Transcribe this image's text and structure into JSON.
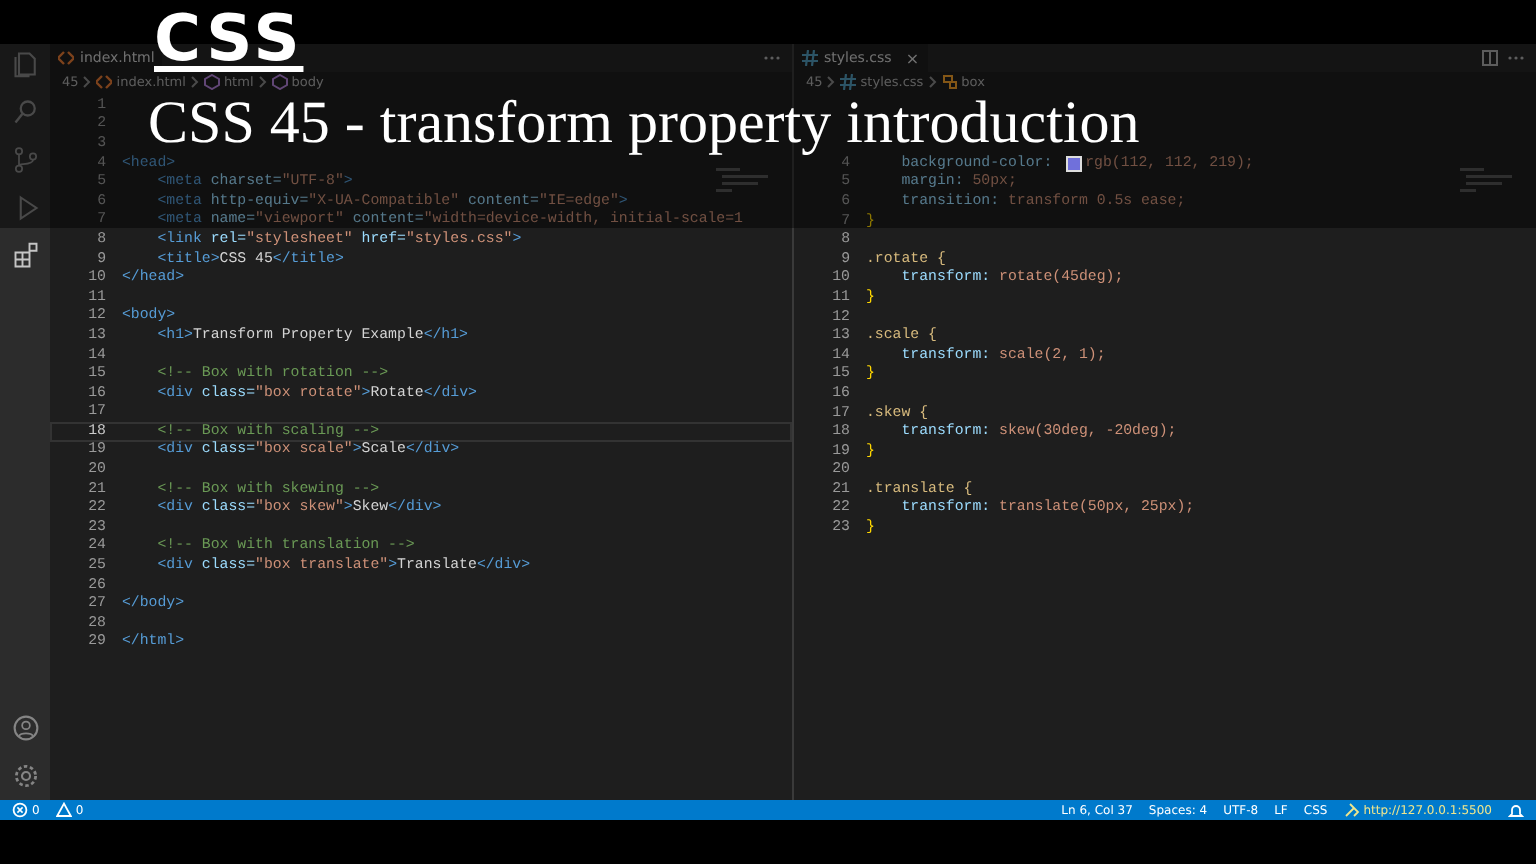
{
  "overlay": {
    "badge": "CSS",
    "title": "CSS 45 - transform property introduction"
  },
  "activity_bar": {
    "top": [
      {
        "kind": "files"
      },
      {
        "kind": "search"
      },
      {
        "kind": "source-control"
      },
      {
        "kind": "run"
      },
      {
        "kind": "extensions"
      }
    ],
    "bottom": [
      {
        "kind": "account"
      },
      {
        "kind": "settings"
      }
    ]
  },
  "editors": [
    {
      "tab": {
        "label": "index.html"
      },
      "breadcrumb": [
        {
          "text": "45"
        },
        {
          "text": "index.html"
        },
        {
          "text": "html"
        },
        {
          "text": "body"
        }
      ],
      "lines": [
        {
          "n": "1",
          "current": false
        },
        {
          "n": "2",
          "current": false
        },
        {
          "n": "3",
          "current": false
        },
        {
          "n": "4",
          "current": false,
          "tokens": [
            {
              "text": "<head>",
              "kind": "tag"
            }
          ]
        },
        {
          "n": "5",
          "current": false,
          "tokens": [
            {
              "text": "    <meta ",
              "kind": "tag"
            },
            {
              "text": "charset=",
              "kind": "attr"
            },
            {
              "text": "\"UTF-8\"",
              "kind": "str"
            },
            {
              "text": ">",
              "kind": "tag"
            }
          ]
        },
        {
          "n": "6",
          "current": false,
          "tokens": [
            {
              "text": "    <meta ",
              "kind": "tag"
            },
            {
              "text": "http-equiv=",
              "kind": "attr"
            },
            {
              "text": "\"X-UA-Compatible\" ",
              "kind": "str"
            },
            {
              "text": "content=",
              "kind": "attr"
            },
            {
              "text": "\"IE=edge\"",
              "kind": "str"
            },
            {
              "text": ">",
              "kind": "tag"
            }
          ]
        },
        {
          "n": "7",
          "current": false,
          "tokens": [
            {
              "text": "    <meta ",
              "kind": "tag"
            },
            {
              "text": "name=",
              "kind": "attr"
            },
            {
              "text": "\"viewport\" ",
              "kind": "str"
            },
            {
              "text": "content=",
              "kind": "attr"
            },
            {
              "text": "\"width=device-width, initial-scale=1",
              "kind": "str"
            }
          ]
        },
        {
          "n": "8",
          "current": false,
          "tokens": [
            {
              "text": "    <link ",
              "kind": "tag"
            },
            {
              "text": "rel=",
              "kind": "attr"
            },
            {
              "text": "\"stylesheet\" ",
              "kind": "str"
            },
            {
              "text": "href=",
              "kind": "attr"
            },
            {
              "text": "\"styles.css\"",
              "kind": "str"
            },
            {
              "text": ">",
              "kind": "tag"
            }
          ]
        },
        {
          "n": "9",
          "current": false,
          "tokens": [
            {
              "text": "    <title>",
              "kind": "tag"
            },
            {
              "text": "CSS 45",
              "kind": "text"
            },
            {
              "text": "</title>",
              "kind": "tag"
            }
          ]
        },
        {
          "n": "10",
          "current": false,
          "tokens": [
            {
              "text": "</head>",
              "kind": "tag"
            }
          ]
        },
        {
          "n": "11",
          "current": false
        },
        {
          "n": "12",
          "current": false,
          "tokens": [
            {
              "text": "<body>",
              "kind": "tag"
            }
          ]
        },
        {
          "n": "13",
          "current": false,
          "tokens": [
            {
              "text": "    <h1>",
              "kind": "tag"
            },
            {
              "text": "Transform Property Example",
              "kind": "text"
            },
            {
              "text": "</h1>",
              "kind": "tag"
            }
          ]
        },
        {
          "n": "14",
          "current": false
        },
        {
          "n": "15",
          "current": false,
          "tokens": [
            {
              "text": "    <!-- Box with rotation -->",
              "kind": "comment"
            }
          ]
        },
        {
          "n": "16",
          "current": false,
          "tokens": [
            {
              "text": "    <div ",
              "kind": "tag"
            },
            {
              "text": "class=",
              "kind": "attr"
            },
            {
              "text": "\"box rotate\"",
              "kind": "str"
            },
            {
              "text": ">",
              "kind": "tag"
            },
            {
              "text": "Rotate",
              "kind": "text"
            },
            {
              "text": "</div>",
              "kind": "tag"
            }
          ]
        },
        {
          "n": "17",
          "current": false
        },
        {
          "n": "18",
          "current": true,
          "tokens": [
            {
              "text": "    <!-- Box with scaling -->",
              "kind": "comment"
            }
          ]
        },
        {
          "n": "19",
          "current": false,
          "tokens": [
            {
              "text": "    <div ",
              "kind": "tag"
            },
            {
              "text": "class=",
              "kind": "attr"
            },
            {
              "text": "\"box scale\"",
              "kind": "str"
            },
            {
              "text": ">",
              "kind": "tag"
            },
            {
              "text": "Scale",
              "kind": "text"
            },
            {
              "text": "</div>",
              "kind": "tag"
            }
          ]
        },
        {
          "n": "20",
          "current": false
        },
        {
          "n": "21",
          "current": false,
          "tokens": [
            {
              "text": "    <!-- Box with skewing -->",
              "kind": "comment"
            }
          ]
        },
        {
          "n": "22",
          "current": false,
          "tokens": [
            {
              "text": "    <div ",
              "kind": "tag"
            },
            {
              "text": "class=",
              "kind": "attr"
            },
            {
              "text": "\"box skew\"",
              "kind": "str"
            },
            {
              "text": ">",
              "kind": "tag"
            },
            {
              "text": "Skew",
              "kind": "text"
            },
            {
              "text": "</div>",
              "kind": "tag"
            }
          ]
        },
        {
          "n": "23",
          "current": false
        },
        {
          "n": "24",
          "current": false,
          "tokens": [
            {
              "text": "    <!-- Box with translation -->",
              "kind": "comment"
            }
          ]
        },
        {
          "n": "25",
          "current": false,
          "tokens": [
            {
              "text": "    <div ",
              "kind": "tag"
            },
            {
              "text": "class=",
              "kind": "attr"
            },
            {
              "text": "\"box translate\"",
              "kind": "str"
            },
            {
              "text": ">",
              "kind": "tag"
            },
            {
              "text": "Translate",
              "kind": "text"
            },
            {
              "text": "</div>",
              "kind": "tag"
            }
          ]
        },
        {
          "n": "26",
          "current": false
        },
        {
          "n": "27",
          "current": false,
          "tokens": [
            {
              "text": "</body>",
              "kind": "tag"
            }
          ]
        },
        {
          "n": "28",
          "current": false
        },
        {
          "n": "29",
          "current": false,
          "tokens": [
            {
              "text": "</html>",
              "kind": "tag"
            }
          ]
        }
      ]
    },
    {
      "tab": {
        "label": "styles.css",
        "close": "×"
      },
      "breadcrumb": [
        {
          "text": "45"
        },
        {
          "text": "styles.css"
        },
        {
          "text": "box"
        }
      ],
      "lines": [
        {
          "n": "4",
          "tokens": [
            {
              "text": "    background-color: ",
              "kind": "prop"
            },
            {
              "kind": "swatch",
              "color": "#7070db"
            },
            {
              "text": "rgb(112, 112, 219);",
              "kind": "value"
            }
          ]
        },
        {
          "n": "5",
          "tokens": [
            {
              "text": "    margin: ",
              "kind": "prop"
            },
            {
              "text": "50px;",
              "kind": "value"
            }
          ]
        },
        {
          "n": "6",
          "tokens": [
            {
              "text": "    transition: ",
              "kind": "prop"
            },
            {
              "text": "transform 0.5s ease;",
              "kind": "value"
            }
          ]
        },
        {
          "n": "7",
          "tokens": [
            {
              "text": "}",
              "kind": "brace"
            }
          ]
        },
        {
          "n": "8"
        },
        {
          "n": "9",
          "tokens": [
            {
              "text": ".rotate {",
              "kind": "selector"
            }
          ]
        },
        {
          "n": "10",
          "tokens": [
            {
              "text": "    transform: ",
              "kind": "prop"
            },
            {
              "text": "rotate(45deg);",
              "kind": "value"
            }
          ]
        },
        {
          "n": "11",
          "tokens": [
            {
              "text": "}",
              "kind": "brace"
            }
          ]
        },
        {
          "n": "12"
        },
        {
          "n": "13",
          "tokens": [
            {
              "text": ".scale {",
              "kind": "selector"
            }
          ]
        },
        {
          "n": "14",
          "tokens": [
            {
              "text": "    transform: ",
              "kind": "prop"
            },
            {
              "text": "scale(2, 1);",
              "kind": "value"
            }
          ]
        },
        {
          "n": "15",
          "tokens": [
            {
              "text": "}",
              "kind": "brace"
            }
          ]
        },
        {
          "n": "16"
        },
        {
          "n": "17",
          "tokens": [
            {
              "text": ".skew {",
              "kind": "selector"
            }
          ]
        },
        {
          "n": "18",
          "tokens": [
            {
              "text": "    transform: ",
              "kind": "prop"
            },
            {
              "text": "skew(30deg, -20deg);",
              "kind": "value"
            }
          ]
        },
        {
          "n": "19",
          "tokens": [
            {
              "text": "}",
              "kind": "brace"
            }
          ]
        },
        {
          "n": "20"
        },
        {
          "n": "21",
          "tokens": [
            {
              "text": ".translate {",
              "kind": "selector"
            }
          ]
        },
        {
          "n": "22",
          "tokens": [
            {
              "text": "    transform: ",
              "kind": "prop"
            },
            {
              "text": "translate(50px, 25px);",
              "kind": "value"
            }
          ]
        },
        {
          "n": "23",
          "tokens": [
            {
              "text": "}",
              "kind": "brace"
            }
          ]
        }
      ]
    }
  ],
  "status_bar": {
    "left": [
      {
        "kind": "errors",
        "text": "0"
      },
      {
        "kind": "warnings",
        "text": "0"
      }
    ],
    "right": [
      {
        "kind": "text",
        "text": "Ln 6, Col 37"
      },
      {
        "kind": "text",
        "text": "Spaces: 4"
      },
      {
        "kind": "text",
        "text": "UTF-8"
      },
      {
        "kind": "text",
        "text": "LF"
      },
      {
        "kind": "text",
        "text": "CSS"
      },
      {
        "kind": "live",
        "text": "http://127.0.0.1:5500"
      },
      {
        "kind": "bell"
      }
    ]
  }
}
